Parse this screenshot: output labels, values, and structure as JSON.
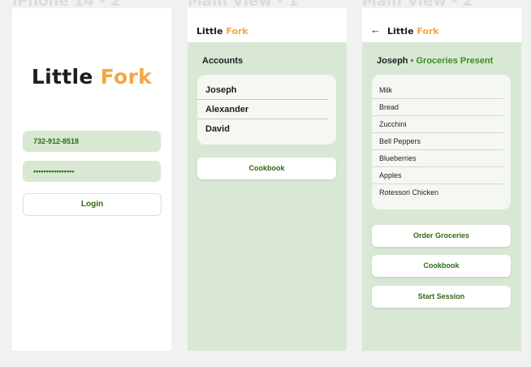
{
  "frames": [
    {
      "title": "iPhone 14 - 2"
    },
    {
      "title": "Main View - 1"
    },
    {
      "title": "Main View - 2"
    }
  ],
  "logo": {
    "part1": "Little",
    "part2": "Fork"
  },
  "colors": {
    "accent_orange": "#f4a647",
    "accent_green": "#3f8a23",
    "panel_green": "#d9e8d5"
  },
  "login": {
    "phone_value": "732-912-8518",
    "password_value": "••••••••••••••••",
    "login_label": "Login"
  },
  "accounts_view": {
    "section_title": "Accounts",
    "accounts": [
      "Joseph",
      "Alexander",
      "David"
    ],
    "cookbook_label": "Cookbook"
  },
  "user_view": {
    "back_icon": "arrow-left-icon",
    "user_name": "Joseph",
    "separator": "•",
    "status": "Groceries Present",
    "groceries": [
      "Milk",
      "Bread",
      "Zucchini",
      "Bell Peppers",
      "Blueberries",
      "Apples",
      "Rotessori Chicken"
    ],
    "order_label": "Order Groceries",
    "cookbook_label": "Cookbook",
    "session_label": "Start Session"
  }
}
